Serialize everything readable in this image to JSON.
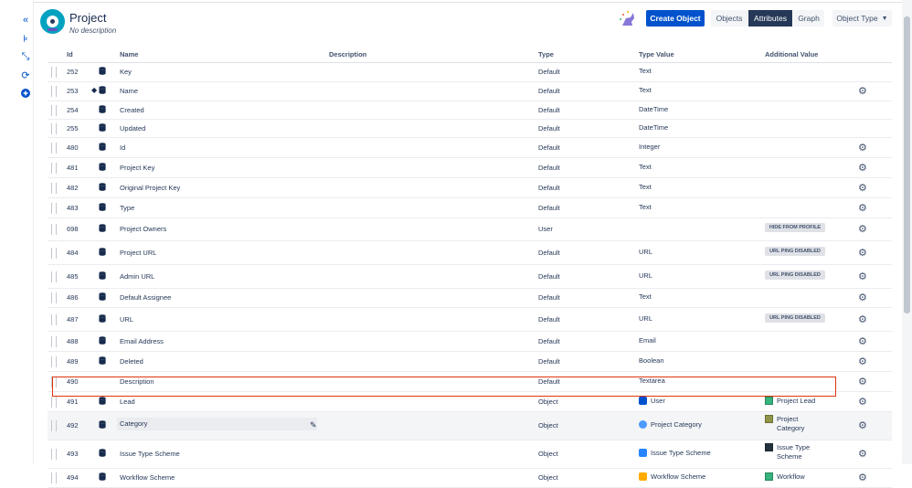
{
  "header": {
    "title": "Project",
    "subtitle": "No description",
    "create_label": "Create Object",
    "tabs": [
      "Objects",
      "Attributes",
      "Graph"
    ],
    "object_type_label": "Object Type"
  },
  "sidebar_icons": [
    "collapse-icon",
    "hierarchy-icon",
    "shrink-icon",
    "refresh-icon",
    "add-icon"
  ],
  "columns": {
    "id": "Id",
    "name": "Name",
    "description": "Description",
    "type": "Type",
    "type_value": "Type Value",
    "additional_value": "Additional Value"
  },
  "rows": [
    {
      "id": "252",
      "name": "Key",
      "type": "Default",
      "type_value": "Text"
    },
    {
      "id": "253",
      "name": "Name",
      "type": "Default",
      "type_value": "Text"
    },
    {
      "id": "254",
      "name": "Created",
      "type": "Default",
      "type_value": "DateTime"
    },
    {
      "id": "255",
      "name": "Updated",
      "type": "Default",
      "type_value": "DateTime"
    },
    {
      "id": "480",
      "name": "Id",
      "type": "Default",
      "type_value": "Integer"
    },
    {
      "id": "481",
      "name": "Project Key",
      "type": "Default",
      "type_value": "Text"
    },
    {
      "id": "482",
      "name": "Original Project Key",
      "type": "Default",
      "type_value": "Text"
    },
    {
      "id": "483",
      "name": "Type",
      "type": "Default",
      "type_value": "Text"
    },
    {
      "id": "698",
      "name": "Project Owners",
      "type": "User",
      "type_value": "",
      "additional": "HIDE FROM PROFILE"
    },
    {
      "id": "484",
      "name": "Project URL",
      "type": "Default",
      "type_value": "URL",
      "additional": "URL PING DISABLED"
    },
    {
      "id": "485",
      "name": "Admin URL",
      "type": "Default",
      "type_value": "URL",
      "additional": "URL PING DISABLED"
    },
    {
      "id": "486",
      "name": "Default Assignee",
      "type": "Default",
      "type_value": "Text"
    },
    {
      "id": "487",
      "name": "URL",
      "type": "Default",
      "type_value": "URL",
      "additional": "URL PING DISABLED"
    },
    {
      "id": "488",
      "name": "Email Address",
      "type": "Default",
      "type_value": "Email"
    },
    {
      "id": "489",
      "name": "Deleted",
      "type": "Default",
      "type_value": "Boolean"
    },
    {
      "id": "490",
      "name": "Description",
      "type": "Default",
      "type_value": "Textarea"
    },
    {
      "id": "491",
      "name": "Lead",
      "type": "Object",
      "type_value": "User",
      "additional": "Project Lead",
      "color": "#36b37e",
      "tv_color": "#0052cc"
    },
    {
      "id": "492",
      "name": "Category",
      "type": "Object",
      "type_value": "Project Category",
      "additional": "Project Category",
      "color": "#8f9448",
      "tv_color": "#4c9aff"
    },
    {
      "id": "493",
      "name": "Issue Type Scheme",
      "type": "Object",
      "type_value": "Issue Type Scheme",
      "additional": "Issue Type Scheme",
      "color": "#22333f",
      "tv_color": "#2684ff"
    },
    {
      "id": "494",
      "name": "Workflow Scheme",
      "type": "Object",
      "type_value": "Workflow Scheme",
      "additional": "Workflow",
      "color": "#36b37e",
      "tv_color": "#ffab00"
    }
  ]
}
